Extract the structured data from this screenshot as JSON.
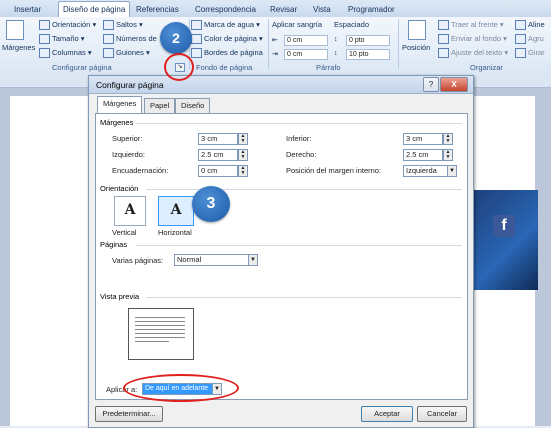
{
  "ribbon": {
    "tabs": [
      "Insertar",
      "Diseño de página",
      "Referencias",
      "Correspondencia",
      "Revisar",
      "Vista",
      "Programador"
    ],
    "active_tab": "Diseño de página",
    "margins_label": "Márgenes",
    "page_setup": [
      "Orientación",
      "Tamaño",
      "Columnas",
      "Saltos",
      "Números de línea",
      "Guiones"
    ],
    "page_setup_group": "Configurar página",
    "background": [
      "Marca de agua",
      "Color de página",
      "Bordes de página"
    ],
    "background_group": "Fondo de página",
    "indent_label": "Aplicar sangría",
    "indent_left": "0 cm",
    "indent_right": "0 cm",
    "spacing_label": "Espaciado",
    "spacing_before": "0 pto",
    "spacing_after": "10 pto",
    "paragraph_group": "Párrafo",
    "position_label": "Posición",
    "arrange": [
      "Traer al frente",
      "Enviar al fondo",
      "Ajuste del texto"
    ],
    "arrange_right": [
      "Aline",
      "Agru",
      "Girar"
    ],
    "arrange_group": "Organizar"
  },
  "dialog": {
    "title": "Configurar página",
    "help": "?",
    "close": "X",
    "tabs": [
      "Márgenes",
      "Papel",
      "Diseño"
    ],
    "margins_section": "Márgenes",
    "top_label": "Superior:",
    "top_value": "3 cm",
    "left_label": "Izquierdo:",
    "left_value": "2.5 cm",
    "gutter_label": "Encuadernación:",
    "gutter_value": "0 cm",
    "bottom_label": "Inferior:",
    "bottom_value": "3 cm",
    "right_label": "Derecho:",
    "right_value": "2.5 cm",
    "gutter_pos_label": "Posición del margen interno:",
    "gutter_pos_value": "Izquierda",
    "orientation_section": "Orientación",
    "portrait_label": "Vertical",
    "landscape_label": "Horizontal",
    "orientation_glyph": "A",
    "pages_section": "Páginas",
    "multiple_pages_label": "Varias páginas:",
    "multiple_pages_value": "Normal",
    "preview_section": "Vista previa",
    "apply_label": "Aplicar a:",
    "apply_value": "De aquí en adelante",
    "default_button": "Predeterminar...",
    "ok_button": "Aceptar",
    "cancel_button": "Cancelar"
  },
  "callouts": {
    "step2": "2",
    "step3": "3"
  },
  "colors": {
    "callout": "#1d5aa8",
    "highlight_ring": "#e0201f",
    "selection": "#3399ff"
  }
}
